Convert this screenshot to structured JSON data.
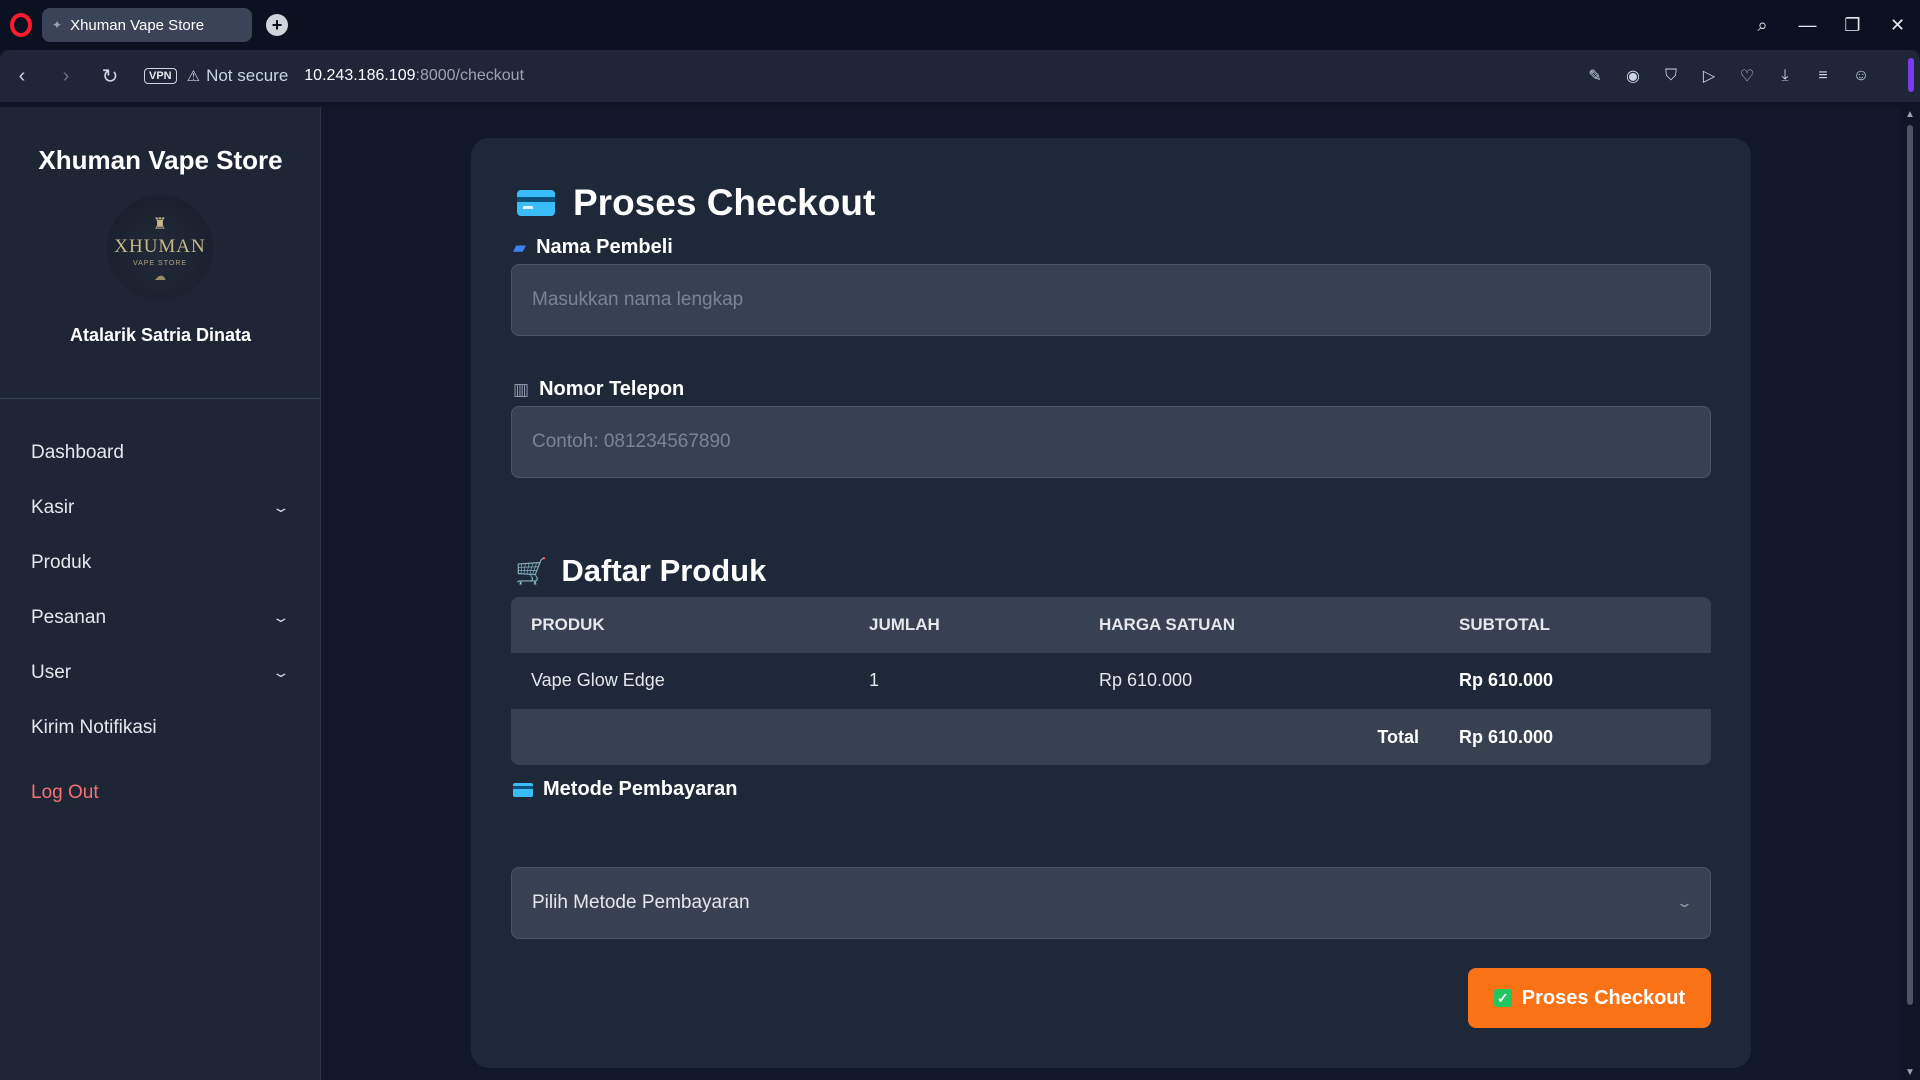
{
  "browser": {
    "tab_title": "Xhuman Vape Store",
    "new_tab": "+",
    "vpn": "VPN",
    "security": "Not secure",
    "url_host": "10.243.186.109",
    "url_rest": ":8000/checkout"
  },
  "sidebar": {
    "brand": "Xhuman Vape Store",
    "logo": {
      "name": "XHUMAN",
      "sub": "VAPE STORE"
    },
    "user": "Atalarik Satria Dinata",
    "items": [
      {
        "label": "Dashboard"
      },
      {
        "label": "Kasir"
      },
      {
        "label": "Produk"
      },
      {
        "label": "Pesanan"
      },
      {
        "label": "User"
      },
      {
        "label": "Kirim Notifikasi"
      }
    ],
    "logout": "Log Out"
  },
  "checkout": {
    "title": "Proses Checkout",
    "name_label": "Nama Pembeli",
    "name_placeholder": "Masukkan nama lengkap",
    "phone_label": "Nomor Telepon",
    "phone_placeholder": "Contoh: 081234567890",
    "products_title": "Daftar Produk",
    "columns": [
      "PRODUK",
      "JUMLAH",
      "HARGA SATUAN",
      "SUBTOTAL"
    ],
    "rows": [
      {
        "product": "Vape Glow Edge",
        "qty": "1",
        "price": "Rp 610.000",
        "subtotal": "Rp 610.000"
      }
    ],
    "total_label": "Total",
    "total_value": "Rp 610.000",
    "payment_label": "Metode Pembayaran",
    "payment_selected": "Pilih Metode Pembayaran",
    "submit_label": "Proses Checkout"
  },
  "colors": {
    "accent": "#f97316",
    "logout": "#f87171",
    "success": "#22c55e"
  }
}
